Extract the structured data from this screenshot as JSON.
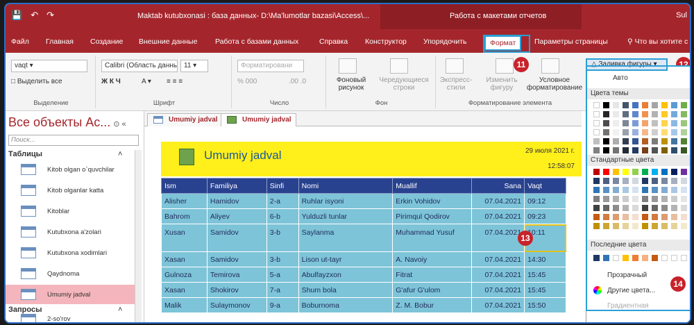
{
  "window": {
    "title": "Maktab kutubxonasi : база данных- D:\\Ma'lumotlar bazasi\\Access\\...",
    "context_label": "Работа с макетами отчетов",
    "user": "Sul"
  },
  "ribbon_tabs": [
    "Файл",
    "Главная",
    "Создание",
    "Внешние данные",
    "Работа с базами данных",
    "Справка",
    "Конструктор",
    "Упорядочить",
    "Формат",
    "Параметры страницы"
  ],
  "tell_me": "Что вы хотите с",
  "ribbon": {
    "selection_field": "vaqt",
    "select_all": "Выделить все",
    "group_selection": "Выделение",
    "font_name": "Calibri (Область данны",
    "font_size": "11",
    "group_font": "Шрифт",
    "format_combo": "Форматировани",
    "number_symbols": "% 000",
    "group_number": "Число",
    "background_image": "Фоновый рисунок",
    "alt_rows": "Чередующиеся строки",
    "group_background": "Фон",
    "quick_styles": "Экспресс-стили",
    "change_shape": "Изменить фигуру",
    "conditional": "Условное форматирование",
    "group_control": "Форматирование элемента",
    "font_buttons": "Ж К Ч",
    "number_decimals": ".00 .0"
  },
  "nav": {
    "title": "Все объекты Ac...",
    "search_placeholder": "Поиск...",
    "section_tables": "Таблицы",
    "section_queries": "Запросы",
    "items": [
      "Kitob olgan o`quvchilar",
      "Kitob olganlar katta",
      "Kitoblar",
      "Kutubxona a'zolari",
      "Kutubxona xodimlari",
      "Qaydnoma",
      "Umumiy jadval"
    ],
    "query_item": "2-so'rov"
  },
  "doc_tabs": [
    "Umumiy jadval",
    "Umumiy jadval"
  ],
  "report": {
    "title": "Umumiy jadval",
    "date": "29 июля 2021 г.",
    "time": "12:58:07",
    "columns": [
      "Ism",
      "Familiya",
      "Sinfi",
      "Nomi",
      "Muallif",
      "Sana",
      "Vaqt"
    ],
    "rows": [
      [
        "Alisher",
        "Hamidov",
        "2-a",
        "Ruhlar isyoni",
        "Erkin Vohidov",
        "07.04.2021",
        "09:12"
      ],
      [
        "Bahrom",
        "Aliyev",
        "6-b",
        "Yulduzli tunlar",
        "Pirimqul Qodirov",
        "07.04.2021",
        "09:23"
      ],
      [
        "Xusan",
        "Samidov",
        "3-b",
        "Saylanma",
        "Muhammad Yusuf",
        "07.04.2021",
        "10:11"
      ],
      [
        "Xasan",
        "Samidov",
        "3-b",
        "Lison ut-tayr",
        "A. Navoiy",
        "07.04.2021",
        "14:30"
      ],
      [
        "Gulnoza",
        "Temirova",
        "5-a",
        "Abulfayzxon",
        "Fitrat",
        "07.04.2021",
        "15:45"
      ],
      [
        "Xasan",
        "Shokirov",
        "7-a",
        "Shum bola",
        "G'afur G'ulom",
        "07.04.2021",
        "15:45"
      ],
      [
        "Malik",
        "Sulaymonov",
        "9-a",
        "Boburnoma",
        "Z. M. Bobur",
        "07.04.2021",
        "15:50"
      ]
    ]
  },
  "fill_menu": {
    "button": "Заливка фигуры",
    "auto": "Авто",
    "theme_colors": "Цвета темы",
    "standard_colors": "Стандартные цвета",
    "recent_colors": "Последние цвета",
    "transparent": "Прозрачный",
    "more_colors": "Другие цвета...",
    "gradient": "Градиентная"
  },
  "badges": [
    "11",
    "12",
    "13",
    "14"
  ],
  "colors": {
    "accent": "#a4262c",
    "header_row": "#29428f",
    "data_row": "#7ec4d8",
    "report_header": "#ffef1a",
    "highlight": "#2a9fd6",
    "badge": "#c8222a"
  }
}
